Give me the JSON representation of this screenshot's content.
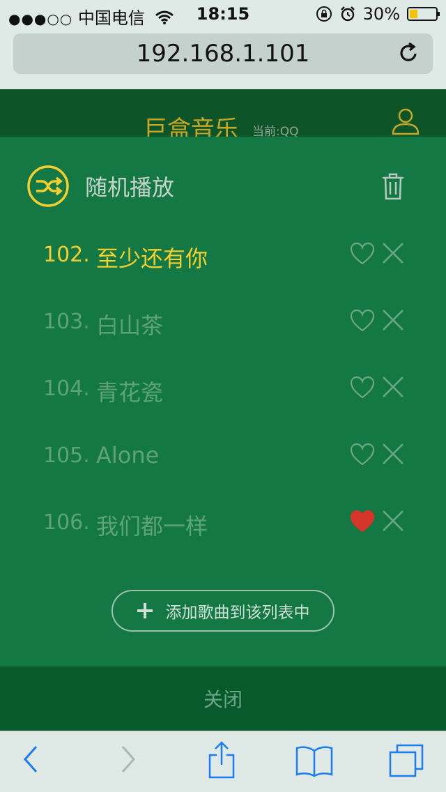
{
  "status_bar": {
    "signal_dots": "●●●○○",
    "carrier": "中国电信",
    "time": "18:15",
    "battery_text": "30%",
    "battery_level": 0.3,
    "battery_color": "#f5c200"
  },
  "browser": {
    "url": "192.168.1.101"
  },
  "app": {
    "title": "巨盒音乐",
    "source_label": "当前:QQ",
    "accent_color": "#c9a726"
  },
  "playlist": {
    "mode_label": "随机播放",
    "songs": [
      {
        "number": "102.",
        "title": "至少还有你",
        "state": "current",
        "liked": false
      },
      {
        "number": "103.",
        "title": "白山茶",
        "state": "normal",
        "liked": false
      },
      {
        "number": "104.",
        "title": "青花瓷",
        "state": "normal",
        "liked": false
      },
      {
        "number": "105.",
        "title": "Alone",
        "state": "normal",
        "liked": false
      },
      {
        "number": "106.",
        "title": "我们都一样",
        "state": "normal",
        "liked": true
      }
    ],
    "add_label": "添加歌曲到该列表中",
    "close_label": "关闭"
  },
  "icons": {
    "wifi": "wifi-icon",
    "rotation_lock": "rotation-lock-icon",
    "alarm": "alarm-icon",
    "reload": "reload-icon",
    "user": "user-icon",
    "shuffle": "shuffle-icon",
    "trash": "trash-icon",
    "heart": "heart-icon",
    "close": "close-icon",
    "plus": "plus-icon",
    "back": "back-icon",
    "forward": "forward-icon",
    "share": "share-icon",
    "bookmarks": "bookmarks-icon",
    "tabs": "tabs-icon"
  }
}
